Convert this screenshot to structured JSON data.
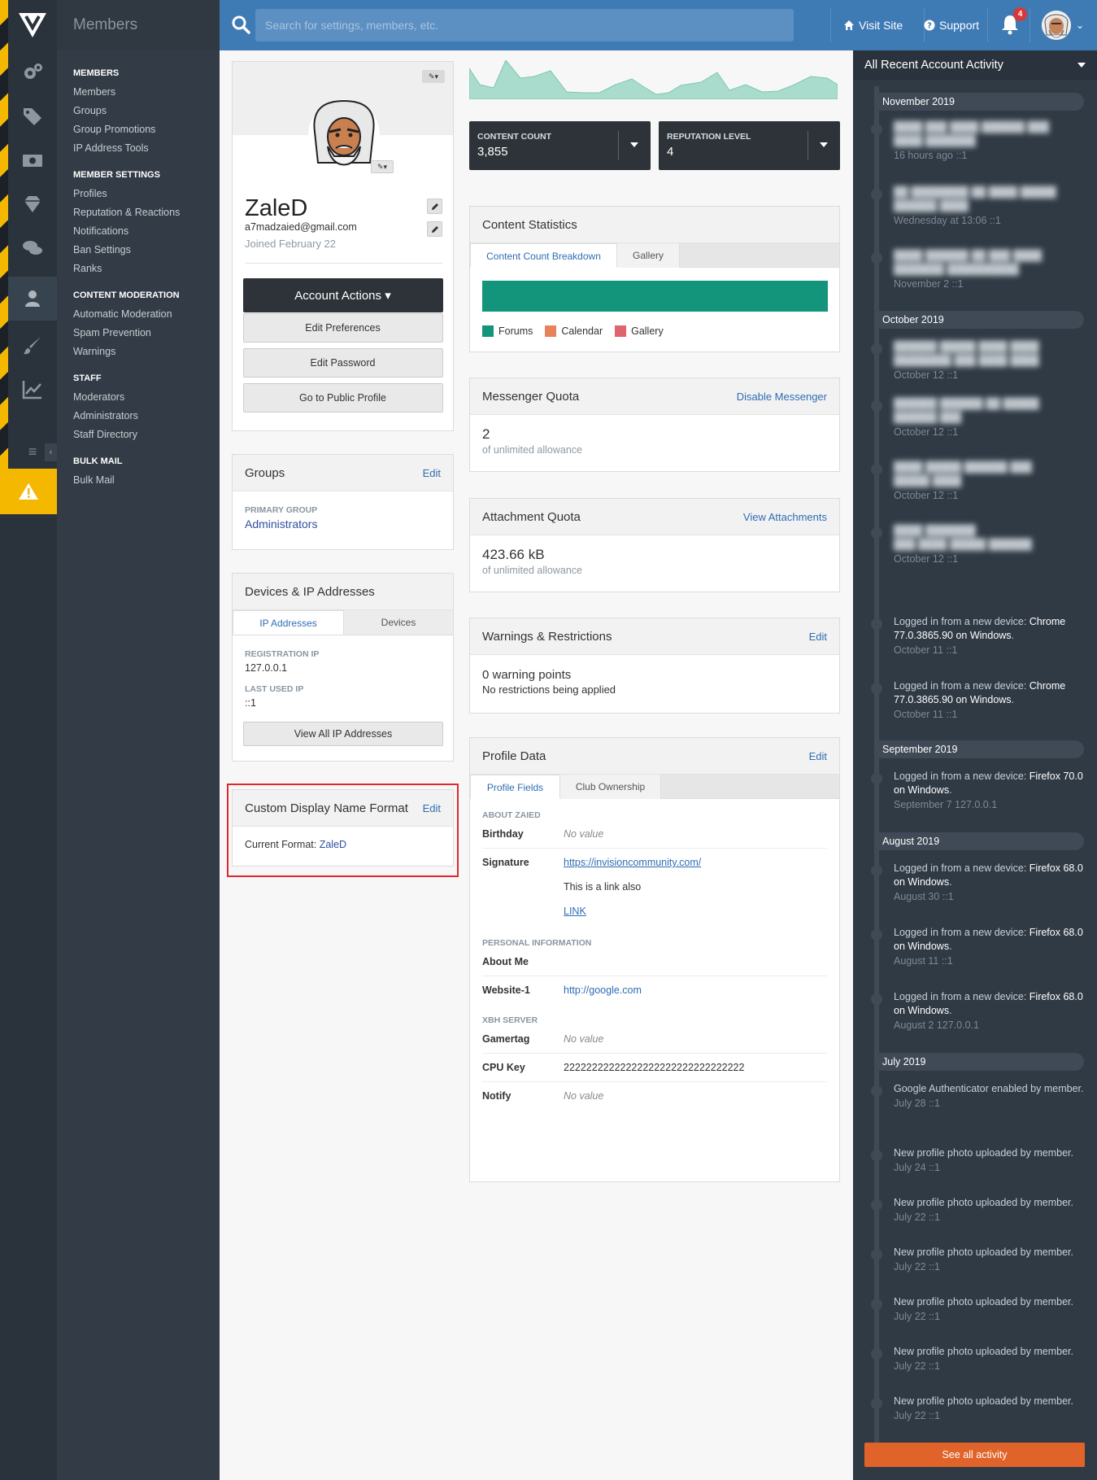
{
  "topbar": {
    "search_placeholder": "Search for settings, members, etc.",
    "visit_site": "Visit Site",
    "support": "Support",
    "notification_count": "4"
  },
  "subnav": {
    "title": "Members",
    "sections": [
      {
        "heading": "MEMBERS",
        "links": [
          "Members",
          "Groups",
          "Group Promotions",
          "IP Address Tools"
        ]
      },
      {
        "heading": "MEMBER SETTINGS",
        "links": [
          "Profiles",
          "Reputation & Reactions",
          "Notifications",
          "Ban Settings",
          "Ranks"
        ]
      },
      {
        "heading": "CONTENT MODERATION",
        "links": [
          "Automatic Moderation",
          "Spam Prevention",
          "Warnings"
        ]
      },
      {
        "heading": "STAFF",
        "links": [
          "Moderators",
          "Administrators",
          "Staff Directory"
        ]
      },
      {
        "heading": "BULK MAIL",
        "links": [
          "Bulk Mail"
        ]
      }
    ]
  },
  "profile": {
    "name": "ZaleD",
    "email": "a7madzaied@gmail.com",
    "joined": "Joined February 22",
    "account_actions": "Account Actions",
    "edit_preferences": "Edit Preferences",
    "edit_password": "Edit Password",
    "public_profile": "Go to Public Profile"
  },
  "groups": {
    "title": "Groups",
    "edit": "Edit",
    "primary_label": "PRIMARY GROUP",
    "primary_value": "Administrators"
  },
  "devices": {
    "title": "Devices & IP Addresses",
    "tab_ip": "IP Addresses",
    "tab_devices": "Devices",
    "reg_label": "REGISTRATION IP",
    "reg_value": "127.0.0.1",
    "last_label": "LAST USED IP",
    "last_value": "::1",
    "view_all": "View All IP Addresses"
  },
  "display_name": {
    "title": "Custom Display Name Format",
    "edit": "Edit",
    "current_label": "Current Format:",
    "current_value": "ZaleD"
  },
  "stats": {
    "content_label": "CONTENT COUNT",
    "content_value": "3,855",
    "rep_label": "REPUTATION LEVEL",
    "rep_value": "4"
  },
  "content_statistics": {
    "title": "Content Statistics",
    "tab_breakdown": "Content Count Breakdown",
    "tab_gallery": "Gallery",
    "legend": [
      {
        "label": "Forums",
        "color": "#13957c"
      },
      {
        "label": "Calendar",
        "color": "#e8825b"
      },
      {
        "label": "Gallery",
        "color": "#e0646b"
      }
    ]
  },
  "messenger": {
    "title": "Messenger Quota",
    "action": "Disable Messenger",
    "value": "2",
    "sub": "of unlimited allowance"
  },
  "attachment": {
    "title": "Attachment Quota",
    "action": "View Attachments",
    "value": "423.66 kB",
    "sub": "of unlimited allowance"
  },
  "warnings": {
    "title": "Warnings & Restrictions",
    "edit": "Edit",
    "points": "0 warning points",
    "restrictions": "No restrictions being applied"
  },
  "profile_data": {
    "title": "Profile Data",
    "edit": "Edit",
    "tab_fields": "Profile Fields",
    "tab_clubs": "Club Ownership",
    "about_heading": "ABOUT ZAIED",
    "birthday_key": "Birthday",
    "birthday_val": "No value",
    "signature_key": "Signature",
    "signature_link": "https://invisioncommunity.com/",
    "signature_text": "This is a link also",
    "signature_link2": "LINK",
    "personal_heading": "PERSONAL INFORMATION",
    "about_me_key": "About Me",
    "website_key": "Website-1",
    "website_val": "http://google.com",
    "xbh_heading": "XBH SERVER",
    "gamertag_key": "Gamertag",
    "gamertag_val": "No value",
    "cpukey_key": "CPU Key",
    "cpukey_val": "22222222222222222222222222222222",
    "notify_key": "Notify",
    "notify_val": "No value"
  },
  "activity": {
    "title": "All Recent Account Activity",
    "months": {
      "nov": "November 2019",
      "oct": "October 2019",
      "sep": "September 2019",
      "aug": "August 2019",
      "jul": "July 2019"
    },
    "entries": {
      "e1_meta": "16 hours ago   ::1",
      "e2_meta": "Wednesday at 13:06   ::1",
      "e3_meta": "November 2   ::1",
      "e4_meta": "October 12   ::1",
      "e5_meta": "October 12   ::1",
      "e6_meta": "October 12   ::1",
      "e7_meta": "October 12   ::1",
      "e8_pre": "Logged in from a new device: ",
      "e8_bold": "Chrome 77.0.3865.90 on Windows",
      "e8_meta": "October 11   ::1",
      "e9_pre": "Logged in from a new device: ",
      "e9_bold": "Chrome 77.0.3865.90 on Windows",
      "e9_meta": "October 11   ::1",
      "e10_pre": "Logged in from a new device: ",
      "e10_bold": "Firefox 70.0 on Windows",
      "e10_meta": "September 7   127.0.0.1",
      "e11_pre": "Logged in from a new device: ",
      "e11_bold": "Firefox 68.0 on Windows",
      "e11_meta": "August 30   ::1",
      "e12_pre": "Logged in from a new device: ",
      "e12_bold": "Firefox 68.0 on Windows",
      "e12_meta": "August 11   ::1",
      "e13_pre": "Logged in from a new device: ",
      "e13_bold": "Firefox 68.0 on Windows",
      "e13_meta": "August 2   127.0.0.1",
      "e14_text": "Google Authenticator enabled by member.",
      "e14_meta": "July 28   ::1",
      "photo_text": "New profile photo uploaded by member.",
      "e15_meta": "July 24   ::1",
      "e16_meta": "July 22   ::1",
      "e17_meta": "July 22   ::1",
      "e18_meta": "July 22   ::1",
      "e19_meta": "July 22   ::1",
      "e20_meta": "July 22   ::1"
    },
    "see_all": "See all activity"
  },
  "colors": {
    "accent": "#3e7ab4",
    "warning": "#f5b800",
    "teal": "#13957c",
    "orange": "#e0632a"
  }
}
